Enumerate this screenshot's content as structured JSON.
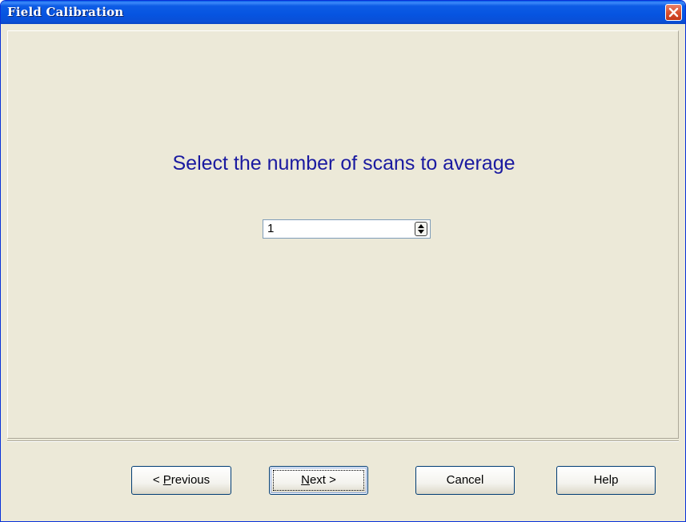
{
  "window": {
    "title": "Field Calibration"
  },
  "wizard": {
    "heading": "Select the number of scans to average",
    "scans_value": "1"
  },
  "buttons": {
    "previous_prefix": "< ",
    "previous_mnemonic": "P",
    "previous_rest": "revious",
    "next_mnemonic": "N",
    "next_rest": "ext >",
    "cancel": "Cancel",
    "help": "Help"
  },
  "colors": {
    "titlebar": "#0654e0",
    "dialog_background": "#ece9d8",
    "heading_text": "#1a1aa0",
    "close_button": "#d9512f"
  },
  "icons": {
    "close": "close-icon",
    "spin_up": "arrow-up-icon",
    "spin_down": "arrow-down-icon"
  }
}
